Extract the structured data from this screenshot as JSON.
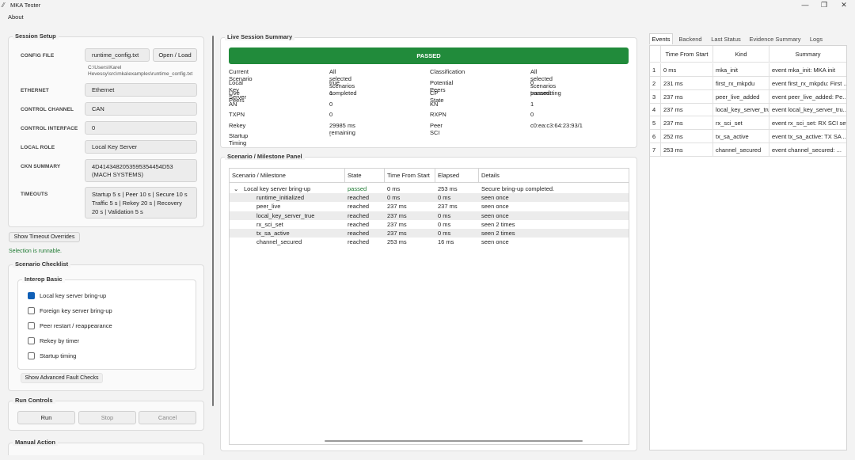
{
  "window": {
    "title": "MKA Tester",
    "minimize": "—",
    "maximize": "❐",
    "close": "✕"
  },
  "menu": {
    "about": "About"
  },
  "session_setup": {
    "title": "Session Setup",
    "config_label": "CONFIG FILE",
    "config_value": "runtime_config.txt",
    "open_load": "Open / Load",
    "config_path_line1": "C:\\Users\\Karel",
    "config_path_line2": "Hevessy\\src\\mka\\examples\\runtime_config.txt",
    "ethernet_label": "ETHERNET",
    "ethernet_value": "Ethernet",
    "control_channel_label": "CONTROL CHANNEL",
    "control_channel_value": "CAN",
    "control_interface_label": "CONTROL INTERFACE",
    "control_interface_value": "0",
    "local_role_label": "LOCAL ROLE",
    "local_role_value": "Local Key Server",
    "ckn_label": "CKN SUMMARY",
    "ckn_line1": "4D4143482053595354454D53",
    "ckn_line2": "(MACH SYSTEMS)",
    "timeouts_label": "TIMEOUTS",
    "timeouts_line1": "Startup 5 s | Peer 10 s | Secure 10 s",
    "timeouts_line2": "Traffic 5 s | Rekey 20 s | Recovery",
    "timeouts_line3": "20 s | Validation 5 s"
  },
  "show_timeout_overrides": "Show Timeout Overrides",
  "selection_status": "Selection is runnable.",
  "scenario_checklist": {
    "title": "Scenario Checklist",
    "group_title": "Interop Basic",
    "items": [
      {
        "label": "Local key server bring-up",
        "checked": true
      },
      {
        "label": "Foreign key server bring-up",
        "checked": false
      },
      {
        "label": "Peer restart / reappearance",
        "checked": false
      },
      {
        "label": "Rekey by timer",
        "checked": false
      },
      {
        "label": "Startup timing",
        "checked": false
      }
    ],
    "advanced": "Show Advanced Fault Checks"
  },
  "run_controls": {
    "title": "Run Controls",
    "run": "Run",
    "stop": "Stop",
    "cancel": "Cancel"
  },
  "manual_action": {
    "title": "Manual Action"
  },
  "live_summary": {
    "title": "Live Session Summary",
    "status": "PASSED",
    "left": [
      {
        "k": "Current Scenario",
        "v": "All selected scenarios completed"
      },
      {
        "k": "Local Key Server",
        "v": "true"
      },
      {
        "k": "Live Peers",
        "v": "1"
      },
      {
        "k": "AN",
        "v": "0"
      },
      {
        "k": "TXPN",
        "v": "0"
      },
      {
        "k": "Rekey",
        "v": "29985 ms remaining"
      },
      {
        "k": "Startup Timing",
        "v": "-"
      }
    ],
    "right": [
      {
        "k": "Classification",
        "v": "All selected scenarios passed."
      },
      {
        "k": "Potential Peers",
        "v": "0"
      },
      {
        "k": "CP State",
        "v": "transmitting"
      },
      {
        "k": "KN",
        "v": "1"
      },
      {
        "k": "RXPN",
        "v": "0"
      },
      {
        "k": "Peer SCI",
        "v": "c0:ea:c3:64:23:93/1"
      }
    ]
  },
  "milestone_panel": {
    "title": "Scenario / Milestone Panel",
    "headers": [
      "Scenario / Milestone",
      "State",
      "Time From Start",
      "Elapsed",
      "Details"
    ],
    "expander": "⌄",
    "rows": [
      {
        "name": "Local key server bring-up",
        "state": "passed",
        "time": "0 ms",
        "elapsed": "253 ms",
        "details": "Secure bring-up completed."
      },
      {
        "name": "runtime_initialized",
        "state": "reached",
        "time": "0 ms",
        "elapsed": "0 ms",
        "details": "seen once"
      },
      {
        "name": "peer_live",
        "state": "reached",
        "time": "237 ms",
        "elapsed": "237 ms",
        "details": "seen once"
      },
      {
        "name": "local_key_server_true",
        "state": "reached",
        "time": "237 ms",
        "elapsed": "0 ms",
        "details": "seen once"
      },
      {
        "name": "rx_sci_set",
        "state": "reached",
        "time": "237 ms",
        "elapsed": "0 ms",
        "details": "seen 2 times"
      },
      {
        "name": "tx_sa_active",
        "state": "reached",
        "time": "237 ms",
        "elapsed": "0 ms",
        "details": "seen 2 times"
      },
      {
        "name": "channel_secured",
        "state": "reached",
        "time": "253 ms",
        "elapsed": "16 ms",
        "details": "seen once"
      }
    ]
  },
  "events_panel": {
    "tabs": [
      "Events",
      "Backend",
      "Last Status",
      "Evidence Summary",
      "Logs"
    ],
    "headers": [
      "Time From Start",
      "Kind",
      "Summary"
    ],
    "rows": [
      {
        "idx": "1",
        "time": "0 ms",
        "kind": "mka_init",
        "summary": "event mka_init: MKA init"
      },
      {
        "idx": "2",
        "time": "231 ms",
        "kind": "first_rx_mkpdu",
        "summary": "event first_rx_mkpdu: First ..."
      },
      {
        "idx": "3",
        "time": "237 ms",
        "kind": "peer_live_added",
        "summary": "event peer_live_added: Pe..."
      },
      {
        "idx": "4",
        "time": "237 ms",
        "kind": "local_key_server_true",
        "summary": "event local_key_server_tru..."
      },
      {
        "idx": "5",
        "time": "237 ms",
        "kind": "rx_sci_set",
        "summary": "event rx_sci_set: RX SCI set"
      },
      {
        "idx": "6",
        "time": "252 ms",
        "kind": "tx_sa_active",
        "summary": "event tx_sa_active: TX SA ..."
      },
      {
        "idx": "7",
        "time": "253 ms",
        "kind": "channel_secured",
        "summary": "event channel_secured: ..."
      }
    ]
  }
}
